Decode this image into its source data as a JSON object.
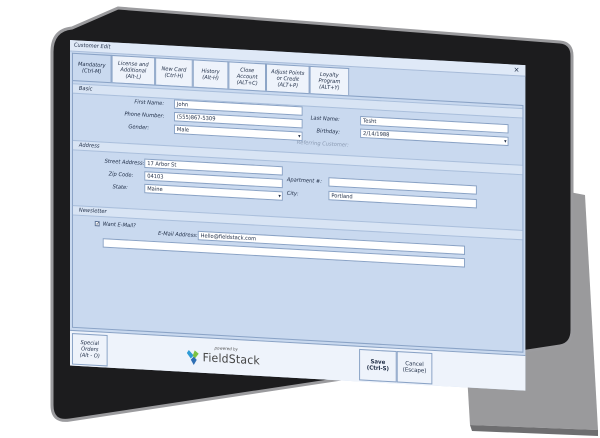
{
  "window": {
    "title": "Customer Edit",
    "close_glyph": "×"
  },
  "tabs": [
    {
      "label": "Mandatory\n(Ctrl-M)"
    },
    {
      "label": "License and\nAdditional\n(Alt-L)"
    },
    {
      "label": "New Card\n(Ctrl-H)"
    },
    {
      "label": "History\n(Alt-H)"
    },
    {
      "label": "Close\nAccount\n(ALT+C)"
    },
    {
      "label": "Adjust Points\nor Credit\n(ALT+P)"
    },
    {
      "label": "Loyalty\nProgram\n(ALT+Y)"
    }
  ],
  "sections": {
    "basic": "Basic",
    "address": "Address",
    "newsletter": "Newsletter"
  },
  "basic": {
    "first_name_label": "First Name:",
    "first_name": "John",
    "last_name_label": "Last Name:",
    "last_name": "Tesht",
    "phone_label": "Phone Number:",
    "phone": "(555)867-5309",
    "birthday_label": "Birthday:",
    "birthday": "2/14/1988",
    "gender_label": "Gender:",
    "gender": "Male",
    "referring_label": "Referring Customer:"
  },
  "address": {
    "street_label": "Street Address:",
    "street": "17 Arbor St",
    "apt_label": "Apartment #:",
    "apt": "",
    "zip_label": "Zip Code:",
    "zip": "04103",
    "city_label": "City:",
    "city": "Portland",
    "state_label": "State:",
    "state": "Maine"
  },
  "newsletter": {
    "want_email_label": "Want E-Mail?",
    "want_email_checked": "✓",
    "email_label": "E-Mail Address:",
    "email": "Hello@fieldstack.com"
  },
  "footer": {
    "special_orders": "Special\nOrders\n(Alt - O)",
    "logo_powered_by": "powered by",
    "logo_name": "FieldStack",
    "save": "Save\n(Ctrl-S)",
    "cancel": "Cancel\n(Escape)"
  }
}
